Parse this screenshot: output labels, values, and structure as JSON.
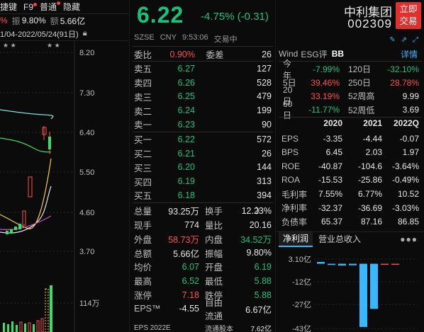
{
  "left": {
    "tabs": [
      "捷键",
      "F9",
      "普通",
      "隐藏"
    ],
    "stats": {
      "pct": "%",
      "zhen_label": "振",
      "zhen": "9.80%",
      "e_label": "额",
      "e": "5.66亿"
    },
    "period": "1/04-2022/05/24(91日)",
    "price_ticks": [
      "8.20",
      "7.30",
      "6.40",
      "5.50",
      "4.60",
      "3.70"
    ],
    "volume_tick": "114万",
    "star_marks": "★ ★"
  },
  "quote": {
    "price": "6.22",
    "change": "-4.75% (-0.31)",
    "market": "SZSE",
    "currency": "CNY",
    "time": "9:53:06",
    "status": "交易中"
  },
  "weibi": {
    "label1": "委比",
    "value1": "0.90%",
    "label2": "委差",
    "value2": "26"
  },
  "asks": [
    {
      "label": "卖五",
      "price": "6.27",
      "vol": "127"
    },
    {
      "label": "卖四",
      "price": "6.26",
      "vol": "528"
    },
    {
      "label": "卖三",
      "price": "6.25",
      "vol": "479"
    },
    {
      "label": "卖二",
      "price": "6.24",
      "vol": "199"
    },
    {
      "label": "卖一",
      "price": "6.23",
      "vol": "90"
    }
  ],
  "bids": [
    {
      "label": "买一",
      "price": "6.22",
      "vol": "572"
    },
    {
      "label": "买二",
      "price": "6.21",
      "vol": "26"
    },
    {
      "label": "买三",
      "price": "6.20",
      "vol": "144"
    },
    {
      "label": "买四",
      "price": "6.19",
      "vol": "313"
    },
    {
      "label": "买五",
      "price": "6.18",
      "vol": "394"
    }
  ],
  "stats": [
    {
      "l1": "总量",
      "v1": "93.25万",
      "c1": "white",
      "l2": "换手",
      "v2": "12.23%",
      "c2": "white"
    },
    {
      "l1": "现手",
      "v1": "774",
      "c1": "white",
      "l2": "量比",
      "v2": "20.16",
      "c2": "white"
    },
    {
      "l1": "外盘",
      "v1": "58.73万",
      "c1": "red",
      "l2": "内盘",
      "v2": "34.52万",
      "c2": "green"
    },
    {
      "l1": "总额",
      "v1": "5.66亿",
      "c1": "white",
      "l2": "振幅",
      "v2": "9.80%",
      "c2": "white"
    },
    {
      "l1": "均价",
      "v1": "6.07",
      "c1": "green",
      "l2": "开盘",
      "v2": "6.19",
      "c2": "green"
    },
    {
      "l1": "最高",
      "v1": "6.52",
      "c1": "green",
      "l2": "最低",
      "v2": "5.88",
      "c2": "green"
    },
    {
      "l1": "涨停",
      "v1": "7.18",
      "c1": "red",
      "l2": "跌停",
      "v2": "5.88",
      "c2": "green"
    },
    {
      "l1": "EPS™",
      "v1": "-4.55",
      "c1": "white",
      "l2": "自由流通",
      "v2": "6.67亿",
      "c2": "white"
    }
  ],
  "bottom_partial": {
    "l1": "EPS 2022E",
    "l2": "流通股本",
    "v2": "7.62亿"
  },
  "company": {
    "name": "中利集团",
    "code": "002309",
    "trade_button": "立即交易"
  },
  "right_tabs": {
    "wind": "Wind",
    "esg": "ESG评",
    "bb": "BB",
    "detail": "详情"
  },
  "performance": [
    {
      "l1": "今年",
      "v1": "-7.99%",
      "c1": "green",
      "l2": "120日",
      "v2": "-32.10%",
      "c2": "green"
    },
    {
      "l1": "5日",
      "v1": "39.46%",
      "c1": "red",
      "l2": "250日",
      "v2": "28.78%",
      "c2": "red"
    },
    {
      "l1": "20日",
      "v1": "33.19%",
      "c1": "red",
      "l2": "52周高",
      "v2": "9.99",
      "c2": "white"
    },
    {
      "l1": "60日",
      "v1": "-11.77%",
      "c1": "green",
      "l2": "52周低",
      "v2": "3.69",
      "c2": "white"
    }
  ],
  "fin_years": [
    "2020",
    "2021",
    "2022Q"
  ],
  "financials": [
    {
      "label": "EPS",
      "v": [
        "-3.35",
        "-4.44",
        "-0.07"
      ]
    },
    {
      "label": "BPS",
      "v": [
        "6.45",
        "2.03",
        "1.97"
      ]
    },
    {
      "label": "ROE",
      "v": [
        "-40.87",
        "-104.6",
        "-3.64%"
      ]
    },
    {
      "label": "ROA",
      "v": [
        "-15.53",
        "-25.86",
        "-0.49%"
      ]
    },
    {
      "label": "毛利率",
      "v": [
        "7.55%",
        "6.77%",
        "10.52"
      ]
    },
    {
      "label": "净利率",
      "v": [
        "-32.37",
        "-36.69",
        "-3.03%"
      ]
    },
    {
      "label": "负债率",
      "v": [
        "65.37",
        "87.16",
        "86.85"
      ]
    }
  ],
  "bottom_tabs": {
    "active": "净利润",
    "other": "营业总收入",
    "more": "●●●"
  },
  "profit_axis": [
    "3.10亿",
    "-12亿",
    "-27亿",
    "-43亿"
  ],
  "chart_data": {
    "type": "bar",
    "title": "净利润",
    "ylabel": "",
    "ylim": [
      -43,
      3.1
    ],
    "values": [
      1.2,
      -0.8,
      -1.2,
      -1.0,
      -42,
      -30,
      -0.6,
      -0.4
    ],
    "colors": [
      "#39b7ff",
      "#39b7ff",
      "#39b7ff",
      "#39b7ff",
      "#39b7ff",
      "#39b7ff",
      "#ff4d4d",
      "#ff4d4d"
    ]
  },
  "colors": {
    "up": "#ff4d4d",
    "down": "#19c27a",
    "accent": "#39b7ff"
  }
}
